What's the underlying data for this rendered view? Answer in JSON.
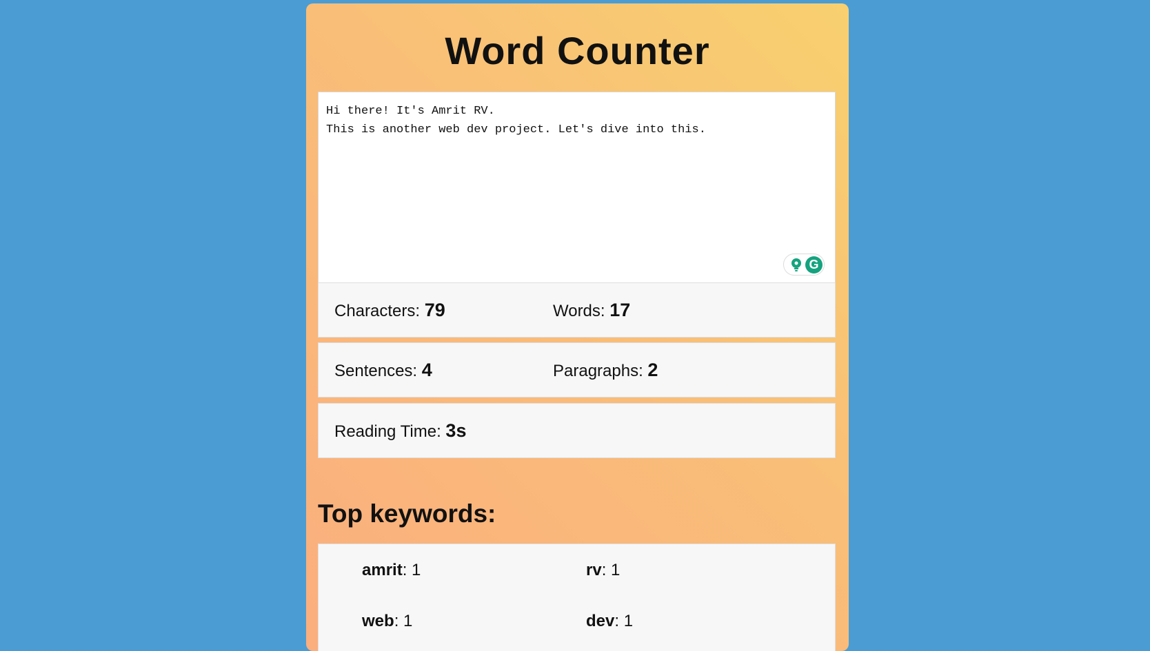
{
  "app": {
    "title": "Word Counter"
  },
  "editor": {
    "text": "Hi there! It's Amrit RV.\nThis is another web dev project. Let's dive into this."
  },
  "stats": {
    "characters": {
      "label": "Characters: ",
      "value": "79"
    },
    "words": {
      "label": "Words: ",
      "value": "17"
    },
    "sentences": {
      "label": "Sentences: ",
      "value": "4"
    },
    "paragraphs": {
      "label": "Paragraphs: ",
      "value": "2"
    },
    "reading_time": {
      "label": "Reading Time: ",
      "value": "3s"
    }
  },
  "keywords": {
    "heading": "Top keywords:",
    "items": [
      {
        "word": "amrit",
        "count": ": 1"
      },
      {
        "word": "rv",
        "count": ": 1"
      },
      {
        "word": "web",
        "count": ": 1"
      },
      {
        "word": "dev",
        "count": ": 1"
      }
    ]
  },
  "grammarly": {
    "logo_letter": "G",
    "icons": [
      "lightbulb-icon",
      "grammarly-icon"
    ]
  },
  "colors": {
    "background": "#4b9cd3",
    "card_gradient_start": "#f8d06f",
    "card_gradient_end": "#fbae7e",
    "panel": "#f7f7f7",
    "grammarly_green": "#15a37f"
  }
}
